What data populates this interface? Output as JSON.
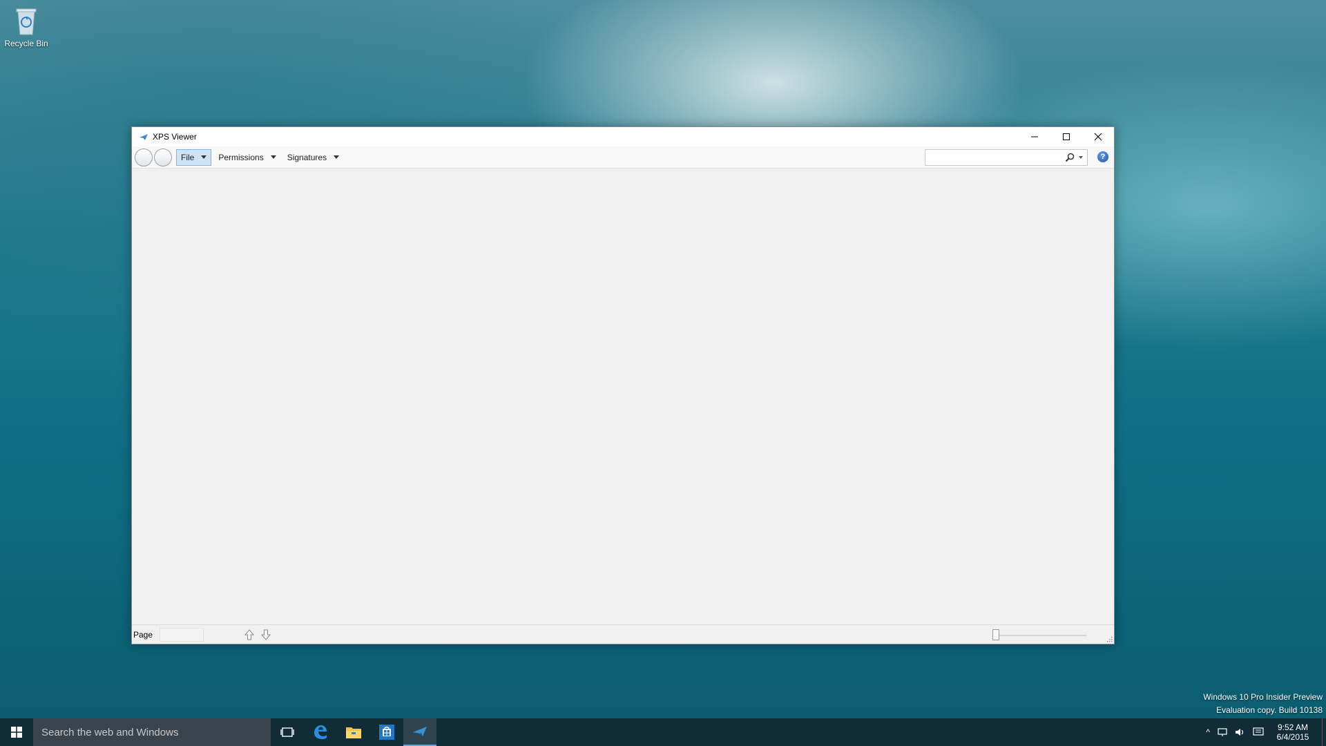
{
  "desktop": {
    "recycle_bin_label": "Recycle Bin"
  },
  "window": {
    "title": "XPS Viewer",
    "app_icon": "xps-viewer-icon",
    "controls": {
      "minimize": "minimize-icon",
      "maximize": "maximize-icon",
      "close": "close-icon"
    }
  },
  "toolbar": {
    "menus": [
      {
        "label": "File",
        "active": true
      },
      {
        "label": "Permissions",
        "active": false
      },
      {
        "label": "Signatures",
        "active": false
      }
    ],
    "search": {
      "value": "",
      "placeholder": ""
    },
    "help_icon": "help-icon"
  },
  "statusbar": {
    "page_label": "Page",
    "page_value": "",
    "zoom_level": 0
  },
  "taskbar": {
    "search_placeholder": "Search the web and Windows",
    "pinned": [
      "task-view-icon",
      "edge-icon",
      "file-explorer-icon",
      "store-icon",
      "xps-viewer-icon"
    ],
    "clock_time": "9:52 AM",
    "clock_date": "6/4/2015"
  },
  "watermark": {
    "line1": "Windows 10 Pro Insider Preview",
    "line2": "Evaluation copy. Build 10138"
  },
  "colors": {
    "accent": "#cde4f7",
    "accent_border": "#7eb4ea",
    "help_blue": "#1d4fa8"
  }
}
